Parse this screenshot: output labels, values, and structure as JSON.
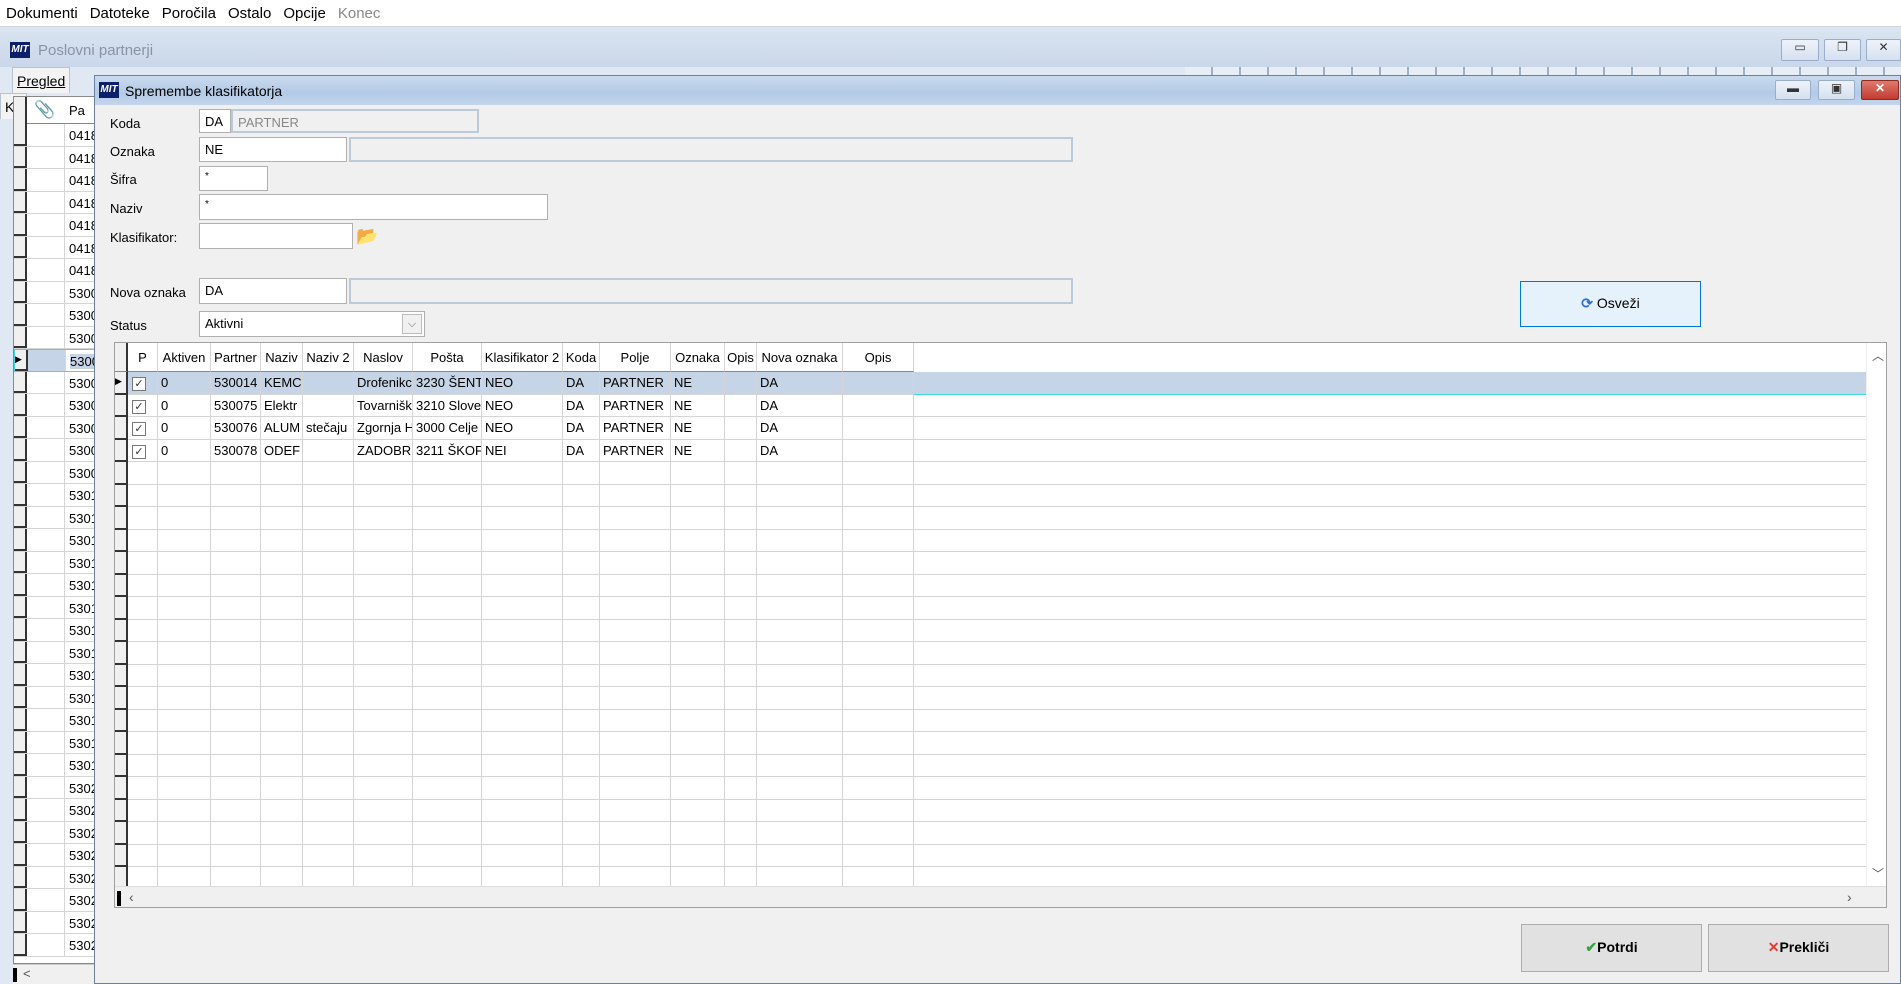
{
  "menu": [
    "Dokumenti",
    "Datoteke",
    "Poročila",
    "Ostalo",
    "Opcije",
    "Konec"
  ],
  "bg_window": {
    "logo": "MIT",
    "title": "Poslovni partnerji",
    "tabs": [
      "Pregled",
      "Ko"
    ],
    "grid_header": "Pa",
    "rows": [
      "0418",
      "0418",
      "0418",
      "0418",
      "0418",
      "0418",
      "0418",
      "5300",
      "5300",
      "5300",
      "5300",
      "5300",
      "5300",
      "5300",
      "5300",
      "5300",
      "5301",
      "5301",
      "5301",
      "5301",
      "5301",
      "5301",
      "5301",
      "5301",
      "5301",
      "5301",
      "5301",
      "5301",
      "5301",
      "5302",
      "5302",
      "5302",
      "5302",
      "5302",
      "5302",
      "5302",
      "5302"
    ],
    "selected_row": 10,
    "scroll_left": "<"
  },
  "dialog": {
    "logo": "MIT",
    "title": "Spremembe klasifikatorja",
    "form": {
      "koda_label": "Koda",
      "koda_value": "DA",
      "koda_desc": "PARTNER",
      "oznaka_label": "Oznaka",
      "oznaka_value": "NE",
      "oznaka_desc": "",
      "sifra_label": "Šifra",
      "sifra_value": "*",
      "naziv_label": "Naziv",
      "naziv_value": "*",
      "klasifikator_label": "Klasifikator:",
      "klasifikator_value": "",
      "nova_oznaka_label": "Nova oznaka",
      "nova_oznaka_value": "DA",
      "nova_oznaka_desc": "",
      "status_label": "Status",
      "status_value": "Aktivni"
    },
    "refresh_label": "Osveži",
    "grid": {
      "columns": [
        "P",
        "Aktiven",
        "Partner",
        "Naziv",
        "Naziv 2",
        "Naslov",
        "Pošta",
        "Klasifikator 2",
        "Koda",
        "Polje",
        "Oznaka",
        "Opis",
        "Nova oznaka",
        "Opis"
      ],
      "rows": [
        [
          true,
          "0",
          "530014",
          "KEMC",
          "",
          "Drofenikc",
          "3230 ŠENT",
          "NEO",
          "DA",
          "PARTNER",
          "NE",
          "",
          "DA",
          ""
        ],
        [
          true,
          "0",
          "530075",
          "Elektr",
          "",
          "Tovarnišk",
          "3210 Slove",
          "NEO",
          "DA",
          "PARTNER",
          "NE",
          "",
          "DA",
          ""
        ],
        [
          true,
          "0",
          "530076",
          "ALUM",
          "stečaju",
          "Zgornja H",
          "3000 Celje",
          "NEO",
          "DA",
          "PARTNER",
          "NE",
          "",
          "DA",
          ""
        ],
        [
          true,
          "0",
          "530078",
          "ODEF",
          "",
          "ZADOBR",
          "3211 ŠKOF",
          "NEI",
          "DA",
          "PARTNER",
          "NE",
          "",
          "DA",
          ""
        ]
      ],
      "selected_row": 0
    },
    "confirm_label": "Potrdi",
    "cancel_label": "Prekliči"
  },
  "colors": {
    "accent": "#3fd8e8",
    "selection": "#c5d4e6",
    "close": "#c9463d"
  }
}
